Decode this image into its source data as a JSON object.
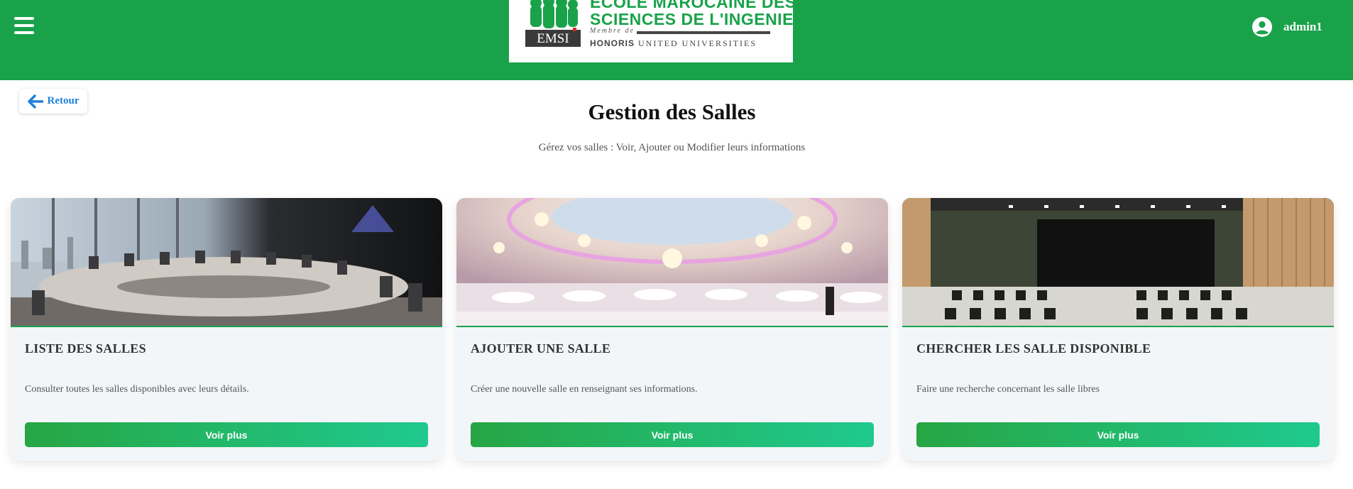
{
  "colors": {
    "header_green": "#19a24a",
    "link_blue": "#1e7fd8",
    "button_gradient_start": "#27a544",
    "button_gradient_end": "#1fc98e"
  },
  "header": {
    "menu_icon": "hamburger-icon",
    "logo": {
      "line1": "ECOLE MAROCAINE DES",
      "line2": "SCIENCES DE L'INGENIEUR",
      "member": "Membre de",
      "honoris": "HONORIS",
      "universities": "UNITED UNIVERSITIES",
      "badge": "EMSI"
    },
    "user": {
      "icon": "account-circle-icon",
      "name": "admin1"
    }
  },
  "back_button": {
    "icon": "arrow-left-icon",
    "label": "Retour"
  },
  "page": {
    "title": "Gestion des Salles",
    "subtitle": "Gérez vos salles : Voir, Ajouter ou Modifier leurs informations"
  },
  "cards": [
    {
      "image": "conference-room-image",
      "title": "LISTE DES SALLES",
      "description": "Consulter toutes les salles disponibles avec leurs détails.",
      "button": "Voir plus"
    },
    {
      "image": "banquet-hall-image",
      "title": "AJOUTER UNE SALLE",
      "description": "Créer une nouvelle salle en renseignant ses informations.",
      "button": "Voir plus"
    },
    {
      "image": "auditorium-image",
      "title": "CHERCHER LES SALLE DISPONIBLE",
      "description": "Faire une recherche concernant les salle libres",
      "button": "Voir plus"
    }
  ]
}
